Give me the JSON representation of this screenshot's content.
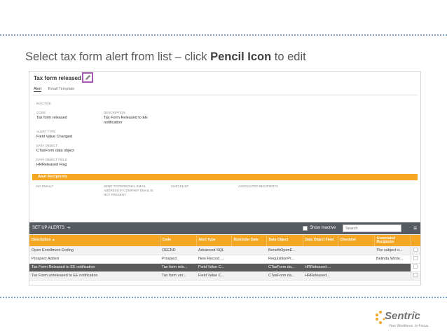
{
  "slide": {
    "title_prefix": "Select tax form alert from list – click ",
    "title_bold": "Pencil Icon",
    "title_suffix": " to edit"
  },
  "detail": {
    "title": "Tax form released",
    "tabs": [
      "Alert",
      "Email Template"
    ],
    "inactive_label": "INACTIVE",
    "code_label": "CODE",
    "code_value": "Tax form released",
    "description_label": "DESCRIPTION",
    "description_value_line1": "Tax Form Released to EE",
    "description_value_line2": "notification",
    "alert_type_label": "ALERT TYPE",
    "alert_type_value": "Field Value Changed",
    "data_object_label": "DATA OBJECT",
    "data_object_value": "CTaxForm data object",
    "data_object_field_label": "DATA OBJECT FIELD",
    "data_object_field_value": "HRReleased Flag",
    "recipients_band": "Alert Recipients",
    "recipients": {
      "no_email_label": "NO EMAIL?",
      "send_personal_line1": "SEND TO PERSONAL EMAIL",
      "send_personal_line2": "ADDRESS IF COMPANY EMAIL IS",
      "send_personal_line3": "NOT PRESENT",
      "checklist_label": "CHECKLIST",
      "associated_label": "ASSOCIATED RECIPIENTS"
    }
  },
  "toolbar": {
    "label": "SET UP ALERTS",
    "add": "+",
    "show_inactive": "Show Inactive",
    "search_placeholder": "Search",
    "menu": "≡"
  },
  "table": {
    "headers": [
      "Description ▲",
      "Code",
      "Alert Type",
      "Reminder Date",
      "Data Object",
      "Data Object Field",
      "Checklist",
      "Associated Recipients"
    ],
    "rows": [
      [
        "Open Enrollment Ending",
        "OEEND",
        "Advanced SQL",
        "",
        "BenefitOpenE...",
        "",
        "",
        "The subject o..."
      ],
      [
        "Prospect Added",
        "Prospect",
        "New Record ...",
        "",
        "RequisitionPr...",
        "",
        "",
        "Belinda Winte..."
      ],
      [
        "Tax Form Released to EE notification",
        "Tax form rele...",
        "Field Value C...",
        "",
        "CTaxForm da...",
        "HRReleased ...",
        "",
        ""
      ],
      [
        "Tax Form unreleased to EE notification",
        "Tax form unr...",
        "Field Value C...",
        "",
        "CTaxForm da...",
        "HRReleased...",
        "",
        ""
      ]
    ]
  },
  "logo": {
    "word": "Sentric",
    "tm": "™",
    "tagline": "Your Workforce. In Focus."
  },
  "colors": {
    "accent": "#f5a623",
    "highlight_border": "#a55ab5",
    "toolbar": "#555b61",
    "selected_row": "#5a5a5a"
  }
}
